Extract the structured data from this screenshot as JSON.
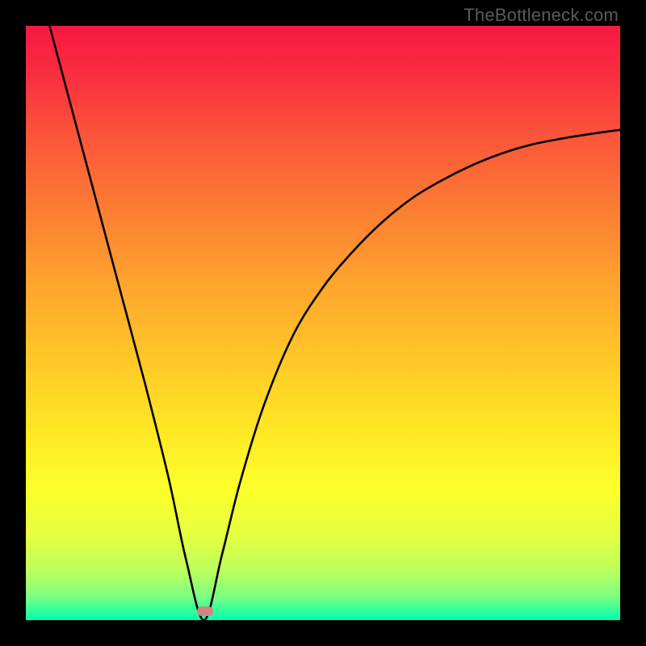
{
  "watermark": "TheBottleneck.com",
  "gradient": {
    "stops": [
      {
        "offset": 0.0,
        "color": "#f71843"
      },
      {
        "offset": 0.08,
        "color": "#f92d40"
      },
      {
        "offset": 0.18,
        "color": "#fb533a"
      },
      {
        "offset": 0.3,
        "color": "#fc7a33"
      },
      {
        "offset": 0.42,
        "color": "#fea02e"
      },
      {
        "offset": 0.55,
        "color": "#ffc428"
      },
      {
        "offset": 0.68,
        "color": "#ffe725"
      },
      {
        "offset": 0.78,
        "color": "#fcff2a"
      },
      {
        "offset": 0.86,
        "color": "#e4ff41"
      },
      {
        "offset": 0.92,
        "color": "#b8ff5e"
      },
      {
        "offset": 0.96,
        "color": "#7cff83"
      },
      {
        "offset": 1.0,
        "color": "#00ffb0"
      }
    ]
  },
  "marker": {
    "x_frac": 0.302,
    "y_frac": 0.985,
    "color": "#d98084"
  },
  "chart_data": {
    "type": "line",
    "title": "",
    "xlabel": "",
    "ylabel": "",
    "xlim": [
      0,
      100
    ],
    "ylim": [
      0,
      100
    ],
    "note": "No axis ticks or labels are drawn in the image. The curve depicts a V-shaped bottleneck profile with a minimum near x≈30, rising steeply on the left and asymptotically toward ~82 on the right. Values below are read off the black curve at evenly spaced x positions.",
    "series": [
      {
        "name": "bottleneck-curve",
        "x": [
          4,
          8,
          12,
          16,
          20,
          24,
          27,
          30,
          33,
          36,
          40,
          45,
          50,
          55,
          60,
          65,
          70,
          75,
          80,
          85,
          90,
          95,
          100
        ],
        "y": [
          100,
          85,
          70,
          55,
          40,
          24,
          10,
          0,
          11,
          23,
          36,
          48,
          56,
          62,
          67,
          71,
          74,
          76.5,
          78.5,
          80,
          81,
          81.8,
          82.5
        ]
      }
    ],
    "minimum_point": {
      "x": 30,
      "y": 0
    }
  }
}
